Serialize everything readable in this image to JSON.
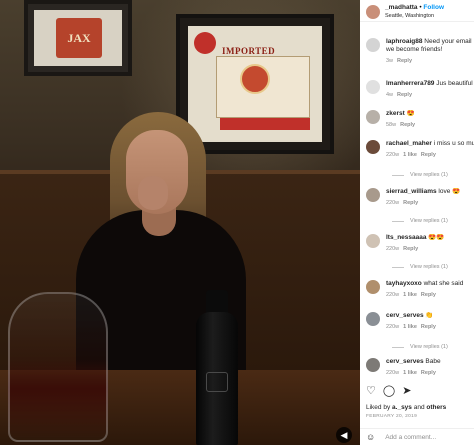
{
  "post": {
    "username": "_madhatta",
    "follow_label": "Follow",
    "separator": "•",
    "location": "Seattle, Washington"
  },
  "photo": {
    "poster_1_text": "JAX",
    "poster_2_text": "IMPORTED"
  },
  "comments": [
    {
      "user": "laphroaig88",
      "text": "Need your email",
      "text2": "we become friends!",
      "time": "3w",
      "reply": "Reply",
      "likes": "",
      "replies": ""
    },
    {
      "user": "lmanherrera789",
      "text": "Jus beautiful",
      "text2": "",
      "time": "4w",
      "reply": "Reply",
      "likes": "",
      "replies": ""
    },
    {
      "user": "zkerst",
      "text": "😍",
      "text2": "",
      "time": "58w",
      "reply": "Reply",
      "likes": "",
      "replies": ""
    },
    {
      "user": "rachael_maher",
      "text": "i miss u so much",
      "text2": "",
      "time": "220w",
      "reply": "Reply",
      "likes": "1 like",
      "replies": "View replies (1)"
    },
    {
      "user": "sierrad_williams",
      "text": "love 😍",
      "text2": "",
      "time": "220w",
      "reply": "Reply",
      "likes": "",
      "replies": "View replies (1)"
    },
    {
      "user": "lts_nessaaaa",
      "text": "😍😍",
      "text2": "",
      "time": "220w",
      "reply": "Reply",
      "likes": "",
      "replies": "View replies (1)"
    },
    {
      "user": "tayhayxoxo",
      "text": "what she said",
      "text2": "",
      "time": "220w",
      "reply": "Reply",
      "likes": "1 like",
      "replies": ""
    },
    {
      "user": "cerv_serves",
      "text": "👏",
      "text2": "",
      "time": "220w",
      "reply": "Reply",
      "likes": "1 like",
      "replies": "View replies (1)"
    },
    {
      "user": "cerv_serves",
      "text": "Babe",
      "text2": "",
      "time": "220w",
      "reply": "Reply",
      "likes": "1 like",
      "replies": ""
    }
  ],
  "actions": {
    "like_icon": "heart-icon",
    "comment_icon": "comment-icon",
    "share_icon": "share-icon"
  },
  "likes": {
    "prefix": "Liked by",
    "user": "a._sys",
    "and": "and",
    "others": "others"
  },
  "date": "FEBRUARY 20, 2019",
  "add_comment": {
    "emoji_icon": "smiley-icon",
    "placeholder": "Add a comment..."
  }
}
